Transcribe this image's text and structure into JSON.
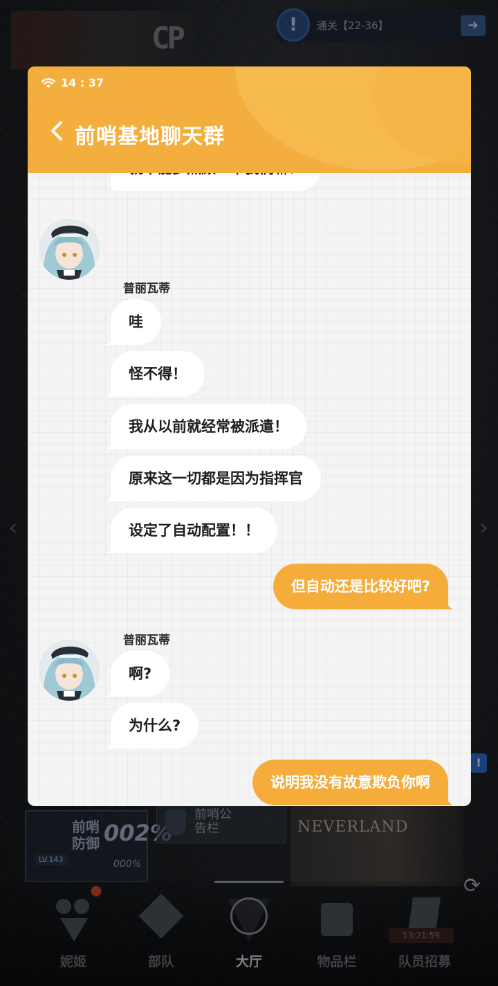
{
  "background": {
    "quest_text": "通关【22-36】",
    "quest_icon": "!",
    "quest_arrow": "➔",
    "hud": {
      "outpost_label": "前哨防御",
      "outpost_percent": "002%",
      "level": "LV.143",
      "percent_small": "000%",
      "board_label": "前哨公告栏"
    },
    "neverland_label": "NEVERLAND",
    "notice_badge": "!",
    "nav": [
      {
        "label": "妮姬"
      },
      {
        "label": "部队"
      },
      {
        "label": "大厅"
      },
      {
        "label": "物品栏"
      },
      {
        "label": "队员招募"
      }
    ],
    "recruit_timer": "13:21:59"
  },
  "dialog": {
    "time": "14 : 37",
    "title": "前哨基地聊天群"
  },
  "messages": {
    "partial_top": "就不能多照顾一下我们嘛！",
    "group1": {
      "sender": "普丽瓦蒂",
      "lines": [
        "哇",
        "怪不得！",
        "我从以前就经常被派遣！",
        "原来这一切都是因为指挥官",
        "设定了自动配置！！"
      ]
    },
    "reply1": "但自动还是比较好吧?",
    "group2": {
      "sender": "普丽瓦蒂",
      "lines": [
        "啊?",
        "为什么?"
      ]
    },
    "reply2": "说明我没有故意欺负你啊",
    "typing": "..."
  },
  "colors": {
    "header": "#f4ae3e",
    "reply_bubble": "#f5ac3b",
    "incoming_bubble": "#ffffff",
    "dialog_bg": "#f4f4f5"
  }
}
